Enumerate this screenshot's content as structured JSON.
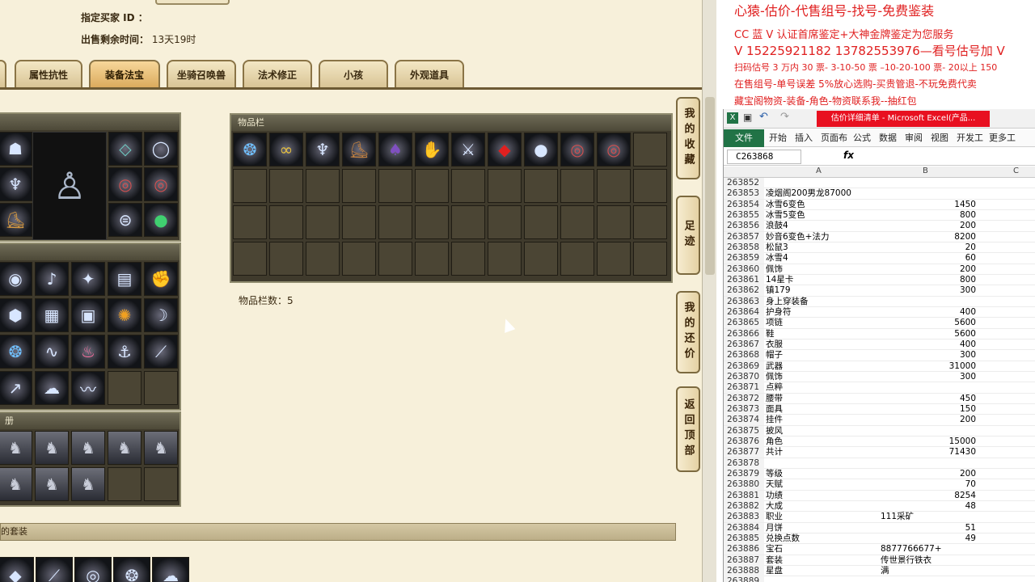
{
  "listing": {
    "buyer_label": "指定买家 ID ：",
    "time_label": "出售剩余时间：",
    "time_value": "13天19时"
  },
  "tabs": [
    {
      "label": "属性抗性",
      "active": false
    },
    {
      "label": "装备法宝",
      "active": true
    },
    {
      "label": "坐骑召唤兽",
      "active": false
    },
    {
      "label": "法术修正",
      "active": false
    },
    {
      "label": "小孩",
      "active": false
    },
    {
      "label": "外观道具",
      "active": false
    }
  ],
  "inventory": {
    "title": "物品栏",
    "count_text": "物品栏数：5",
    "items": [
      "orb-icon",
      "sash-icon",
      "robe-icon",
      "boots-icon",
      "cape-icon",
      "gloves-icon",
      "sword-icon",
      "gem-icon",
      "jade-icon",
      "ring-icon",
      "ring-icon"
    ]
  },
  "equipment_panel_icons": [
    "helmet-icon",
    "character-figure",
    "amulet-icon",
    "necklace-icon",
    "robe-icon",
    "ring-icon",
    "ring-icon",
    "boots-icon",
    "belt-icon",
    "jade-icon"
  ],
  "treasure_panel_icons": [
    "mirror-icon",
    "lute-icon",
    "bell-icon",
    "scroll-icon",
    "gauntlet-icon",
    "shield-icon",
    "book-icon",
    "box-icon",
    "fan-icon",
    "claw-icon",
    "orb-icon",
    "whip-icon",
    "lantern-icon",
    "hook-icon",
    "blade-icon",
    "spear-icon",
    "cloud-icon",
    "ribbon-icon"
  ],
  "bottom_bar": {
    "label": "的套装"
  },
  "side_buttons": [
    {
      "label": "我的收藏"
    },
    {
      "label": "足迹"
    },
    {
      "label": "我的还价"
    },
    {
      "label": "返回顶部"
    }
  ],
  "ad_lines": [
    "心猿-估价-代售组号-找号-免费鉴装",
    "CC 蓝 V 认证首席鉴定+大神金牌鉴定为您服务",
    "V 15225921182      13782553976—看号估号加 V",
    "扫码估号 3 万内 30 票- 3-10-50 票 –10-20-100 票- 20以上 150",
    "在售组号-单号误差 5%放心选购-买贵管退-不玩免费代卖",
    "藏宝阁物资-装备-角色-物资联系我--抽红包"
  ],
  "excel": {
    "title": "估价详细清单 - Microsoft Excel(产品...",
    "file_tab": "文件",
    "menus": [
      "开始",
      "插入",
      "页面布",
      "公式",
      "数据",
      "审阅",
      "视图",
      "开发工",
      "更多工"
    ],
    "name_box": "C263868",
    "fx": "fx",
    "col_headers": [
      "A",
      "B",
      "C"
    ],
    "rows": [
      {
        "n": "263852",
        "a": "",
        "b": ""
      },
      {
        "n": "263853",
        "a": "凌烟阁200男龙87000",
        "b": ""
      },
      {
        "n": "263854",
        "a": "冰雪6变色",
        "b": "1450"
      },
      {
        "n": "263855",
        "a": "冰雪5变色",
        "b": "800"
      },
      {
        "n": "263856",
        "a": "浪鼓4",
        "b": "200"
      },
      {
        "n": "263857",
        "a": "妙音6变色+法力",
        "b": "8200"
      },
      {
        "n": "263858",
        "a": "松鼠3",
        "b": "20"
      },
      {
        "n": "263859",
        "a": "冰雪4",
        "b": "60"
      },
      {
        "n": "263860",
        "a": "佩饰",
        "b": "200"
      },
      {
        "n": "263861",
        "a": "14星卡",
        "b": "800"
      },
      {
        "n": "263862",
        "a": "镇179",
        "b": "300"
      },
      {
        "n": "263863",
        "a": "身上穿装备",
        "b": ""
      },
      {
        "n": "263864",
        "a": "护身符",
        "b": "400"
      },
      {
        "n": "263865",
        "a": "项链",
        "b": "5600"
      },
      {
        "n": "263866",
        "a": "鞋",
        "b": "5600"
      },
      {
        "n": "263867",
        "a": "衣服",
        "b": "400"
      },
      {
        "n": "263868",
        "a": "帽子",
        "b": "300"
      },
      {
        "n": "263869",
        "a": "武器",
        "b": "31000"
      },
      {
        "n": "263870",
        "a": "佩饰",
        "b": "300"
      },
      {
        "n": "263871",
        "a": "点粹",
        "b": ""
      },
      {
        "n": "263872",
        "a": "腰带",
        "b": "450"
      },
      {
        "n": "263873",
        "a": "面具",
        "b": "150"
      },
      {
        "n": "263874",
        "a": "挂件",
        "b": "200"
      },
      {
        "n": "263875",
        "a": "披风",
        "b": ""
      },
      {
        "n": "263876",
        "a": "角色",
        "b": "15000"
      },
      {
        "n": "263877",
        "a": "共计",
        "b": "71430"
      },
      {
        "n": "263878",
        "a": "",
        "b": ""
      },
      {
        "n": "263879",
        "a": "等级",
        "b": "200"
      },
      {
        "n": "263880",
        "a": "天赋",
        "b": "70"
      },
      {
        "n": "263881",
        "a": "功绩",
        "b": "8254"
      },
      {
        "n": "263882",
        "a": "大成",
        "b": "48"
      },
      {
        "n": "263883",
        "a": "职业",
        "b": "111采矿"
      },
      {
        "n": "263884",
        "a": "月饼",
        "b": "51"
      },
      {
        "n": "263885",
        "a": "兑换点数",
        "b": "49"
      },
      {
        "n": "263886",
        "a": "宝石",
        "b": "8877766677+"
      },
      {
        "n": "263887",
        "a": "套装",
        "b": "传世景行铁衣"
      },
      {
        "n": "263888",
        "a": "星盘",
        "b": "满"
      },
      {
        "n": "263889",
        "a": "",
        "b": ""
      }
    ]
  }
}
